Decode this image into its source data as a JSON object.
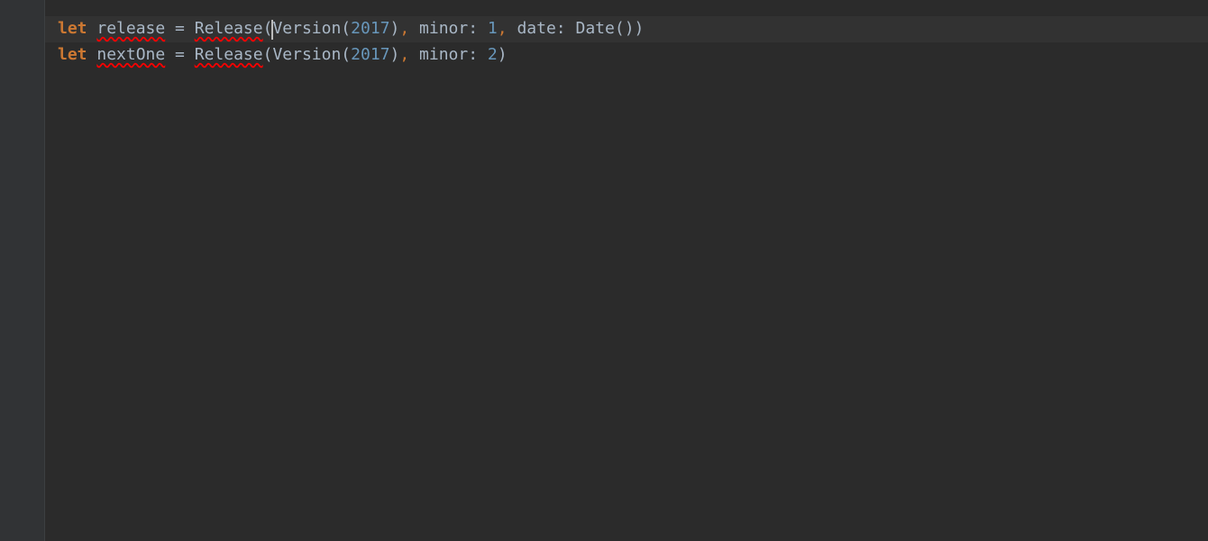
{
  "code": {
    "line1": {
      "keyword": "let",
      "varName": "release",
      "equals": " = ",
      "call1": "Release",
      "open1": "(",
      "call2": "Version",
      "open2": "(",
      "num1": "2017",
      "close2": ")",
      "comma1": ",",
      "space1": " ",
      "param1": "minor",
      "colon1": ": ",
      "num2": "1",
      "comma2": ",",
      "space2": " ",
      "param2": "date",
      "colon2": ": ",
      "call3": "Date",
      "open3": "(",
      "close3": ")",
      "close1": ")"
    },
    "line2": {
      "keyword": "let",
      "varName": "nextOne",
      "equals": " = ",
      "call1": "Release",
      "open1": "(",
      "call2": "Version",
      "open2": "(",
      "num1": "2017",
      "close2": ")",
      "comma1": ",",
      "space1": " ",
      "param1": "minor",
      "colon1": ": ",
      "num2": "2",
      "close1": ")"
    }
  }
}
